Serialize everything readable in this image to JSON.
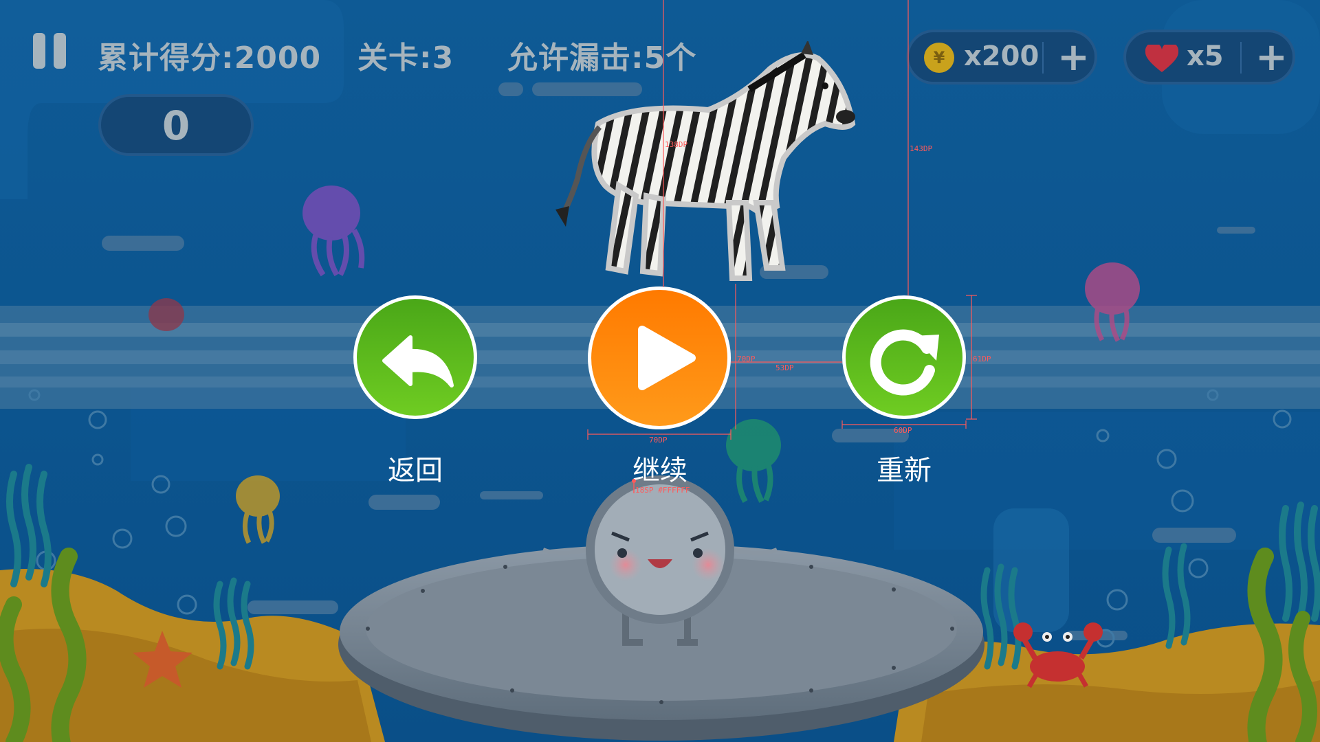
{
  "hud": {
    "total_score_label": "累计得分:2000",
    "level_label": "关卡:3",
    "allowed_miss_label": "允许漏击:5个",
    "current_score": "0",
    "coins": {
      "value": "x200",
      "coin_symbol": "¥",
      "add_symbol": "+"
    },
    "lives": {
      "value": "x5",
      "add_symbol": "+"
    }
  },
  "target_animal": "zebra",
  "menu": {
    "back_label": "返回",
    "continue_label": "继续",
    "restart_label": "重新"
  },
  "annotations": {
    "d1": "138DP",
    "d2": "143DP",
    "d3": "70DP",
    "d4": "53DP",
    "d5": "61DP",
    "d6": "70DP",
    "d7": "60DP",
    "d8": "18SP #FFFFFF"
  },
  "colors": {
    "overlay": "#0b4d86",
    "green_button": "#5bb81e",
    "orange_button": "#ff8a10",
    "hud_text": "#a6b4bd"
  }
}
